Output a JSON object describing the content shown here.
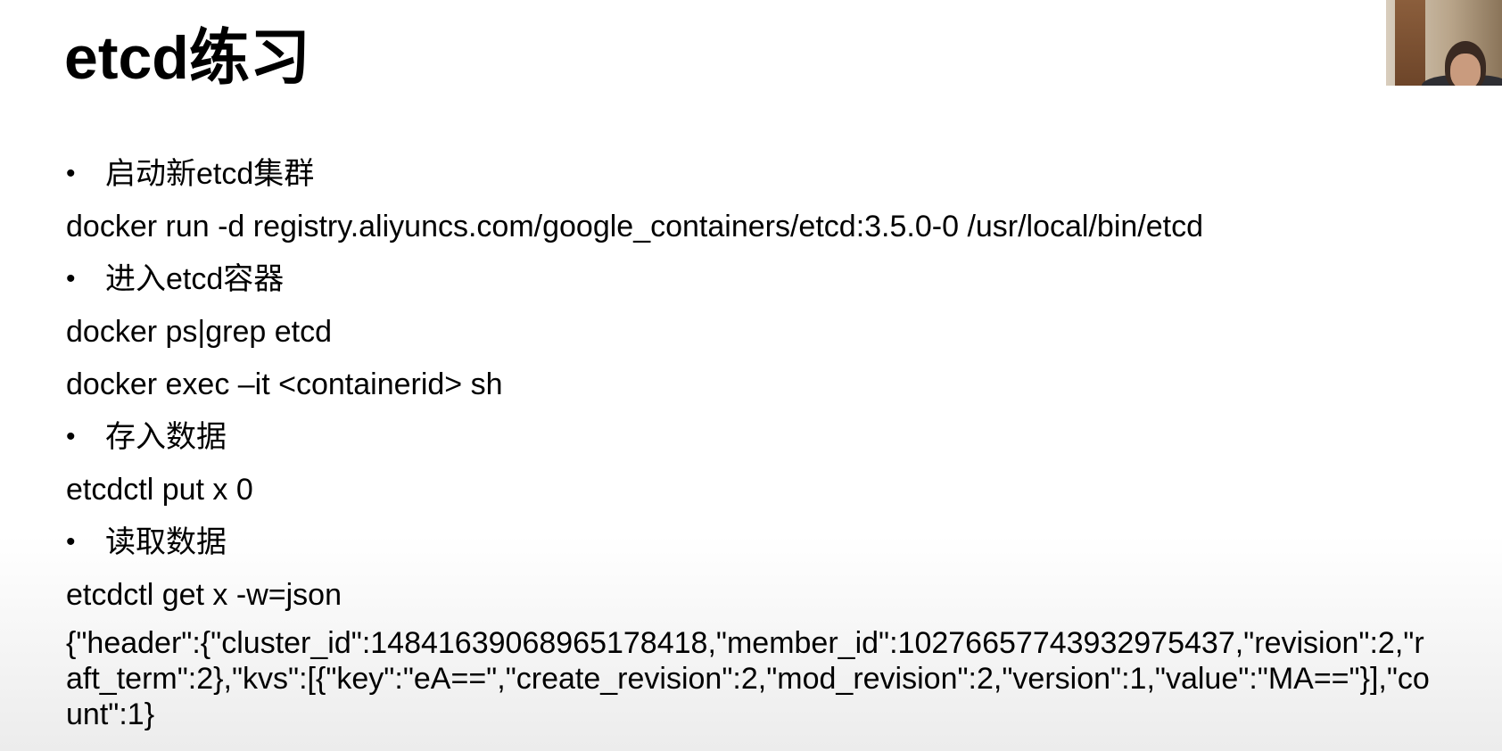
{
  "slide": {
    "title": "etcd练习",
    "items": [
      {
        "kind": "bullet",
        "text": "启动新etcd集群"
      },
      {
        "kind": "code",
        "text": "docker run -d registry.aliyuncs.com/google_containers/etcd:3.5.0-0 /usr/local/bin/etcd"
      },
      {
        "kind": "bullet",
        "text": "进入etcd容器"
      },
      {
        "kind": "code",
        "text": "docker ps|grep etcd"
      },
      {
        "kind": "code",
        "text": "docker exec –it <containerid> sh"
      },
      {
        "kind": "bullet",
        "text": "存入数据"
      },
      {
        "kind": "code",
        "text": "etcdctl put x 0"
      },
      {
        "kind": "bullet",
        "text": "读取数据"
      },
      {
        "kind": "code",
        "text": "etcdctl get x -w=json"
      }
    ],
    "output": "{\"header\":{\"cluster_id\":14841639068965178418,\"member_id\":10276657743932975437,\"revision\":2,\"raft_term\":2},\"kvs\":[{\"key\":\"eA==\",\"create_revision\":2,\"mod_revision\":2,\"version\":1,\"value\":\"MA==\"}],\"count\":1}"
  },
  "bullet_glyph": "•"
}
